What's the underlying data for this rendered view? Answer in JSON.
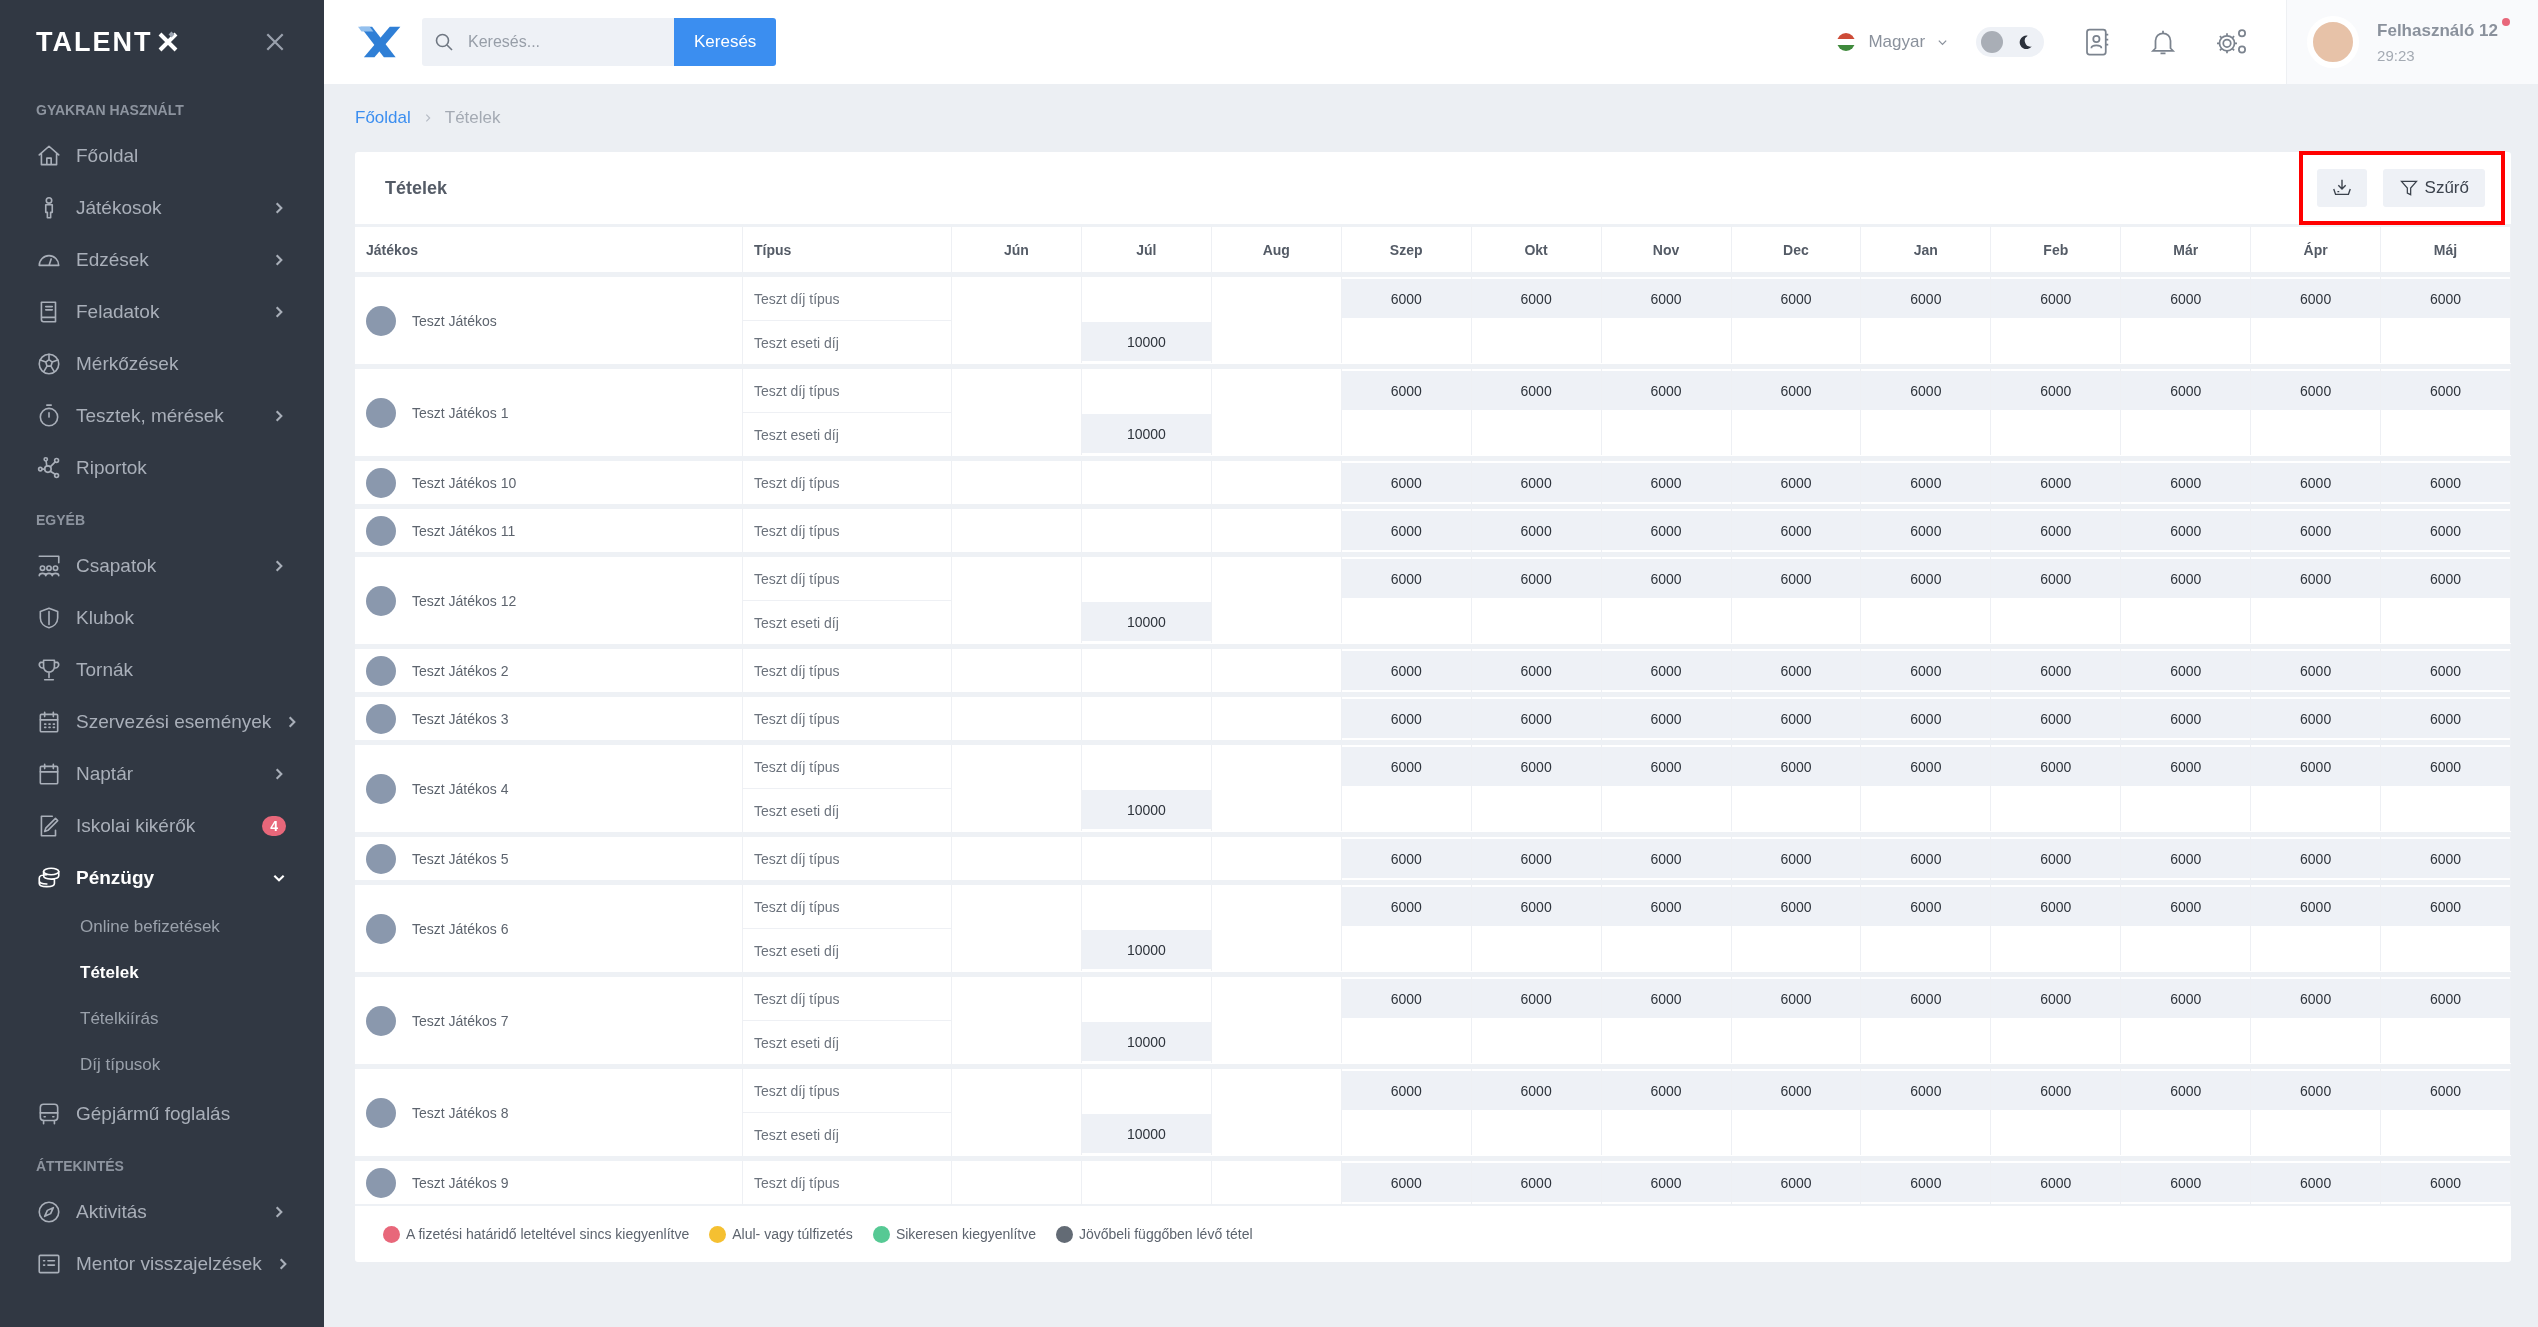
{
  "sidebar": {
    "logo": "TALENT",
    "sections": [
      {
        "title": "GYAKRAN HASZNÁLT",
        "items": [
          {
            "label": "Főoldal",
            "has_submenu": false,
            "selected": false
          },
          {
            "label": "Játékosok",
            "has_submenu": true,
            "expanded": false,
            "selected": false
          },
          {
            "label": "Edzések",
            "has_submenu": true,
            "expanded": false,
            "selected": false
          },
          {
            "label": "Feladatok",
            "has_submenu": true,
            "expanded": false,
            "selected": false
          },
          {
            "label": "Mérkőzések",
            "has_submenu": false,
            "selected": false
          },
          {
            "label": "Tesztek, mérések",
            "has_submenu": true,
            "expanded": false,
            "selected": false
          },
          {
            "label": "Riportok",
            "has_submenu": false,
            "selected": false
          }
        ]
      },
      {
        "title": "EGYÉB",
        "items": [
          {
            "label": "Csapatok",
            "has_submenu": true,
            "expanded": false,
            "selected": false
          },
          {
            "label": "Klubok",
            "has_submenu": false,
            "selected": false
          },
          {
            "label": "Tornák",
            "has_submenu": false,
            "selected": false
          },
          {
            "label": "Szervezési események",
            "has_submenu": true,
            "expanded": false,
            "selected": false
          },
          {
            "label": "Naptár",
            "has_submenu": true,
            "expanded": false,
            "selected": false
          },
          {
            "label": "Iskolai kikérők",
            "has_submenu": false,
            "selected": false,
            "badge": "4"
          },
          {
            "label": "Pénzügy",
            "has_submenu": true,
            "expanded": true,
            "selected": true,
            "children": [
              {
                "label": "Online befizetések",
                "selected": false
              },
              {
                "label": "Tételek",
                "selected": true
              },
              {
                "label": "Tételkiírás",
                "selected": false
              },
              {
                "label": "Díj típusok",
                "selected": false
              }
            ]
          },
          {
            "label": "Gépjármű foglalás",
            "has_submenu": false,
            "selected": false
          }
        ]
      },
      {
        "title": "ÁTTEKINTÉS",
        "items": [
          {
            "label": "Aktivitás",
            "has_submenu": true,
            "expanded": false,
            "selected": false
          },
          {
            "label": "Mentor visszajelzések",
            "has_submenu": true,
            "expanded": false,
            "selected": false
          }
        ]
      }
    ]
  },
  "header": {
    "search": {
      "placeholder": "Keresés..."
    },
    "search_button": "Keresés",
    "language": "Magyar",
    "dark_mode": false,
    "user": {
      "name": "Felhasználó 12",
      "time": "29:23",
      "notification": true
    }
  },
  "breadcrumb": [
    {
      "label": "Főoldal",
      "current": false
    },
    {
      "label": "Tételek",
      "current": true
    }
  ],
  "card": {
    "title": "Tételek",
    "filter_button": "Szűrő",
    "toolbar_highlighted": true
  },
  "table": {
    "columns": [
      "Játékos",
      "Típus",
      "Jún",
      "Júl",
      "Aug",
      "Szep",
      "Okt",
      "Nov",
      "Dec",
      "Jan",
      "Feb",
      "Már",
      "Ápr",
      "Máj"
    ],
    "players": [
      {
        "name": "Teszt Játékos",
        "rows": [
          {
            "type": "Teszt díj típus",
            "cells": [
              {},
              {},
              {},
              {
                "amount": "6000"
              },
              {
                "amount": "6000"
              },
              {
                "amount": "6000"
              },
              {
                "amount": "6000"
              },
              {
                "amount": "6000"
              },
              {
                "amount": "6000"
              },
              {
                "amount": "6000"
              },
              {
                "amount": "6000"
              },
              {
                "amount": "6000"
              }
            ]
          },
          {
            "type": "Teszt eseti díj",
            "cells": [
              {},
              {
                "amount": "10000"
              },
              {},
              {},
              {},
              {},
              {},
              {},
              {},
              {},
              {},
              {}
            ]
          }
        ]
      },
      {
        "name": "Teszt Játékos 1",
        "rows": [
          {
            "type": "Teszt díj típus",
            "cells": [
              {},
              {},
              {},
              {
                "amount": "6000"
              },
              {
                "amount": "6000"
              },
              {
                "amount": "6000"
              },
              {
                "amount": "6000"
              },
              {
                "amount": "6000"
              },
              {
                "amount": "6000"
              },
              {
                "amount": "6000"
              },
              {
                "amount": "6000"
              },
              {
                "amount": "6000"
              }
            ]
          },
          {
            "type": "Teszt eseti díj",
            "cells": [
              {},
              {
                "amount": "10000"
              },
              {},
              {},
              {},
              {},
              {},
              {},
              {},
              {},
              {},
              {}
            ]
          }
        ]
      },
      {
        "name": "Teszt Játékos 10",
        "rows": [
          {
            "type": "Teszt díj típus",
            "cells": [
              {},
              {},
              {},
              {
                "amount": "6000"
              },
              {
                "amount": "6000"
              },
              {
                "amount": "6000"
              },
              {
                "amount": "6000"
              },
              {
                "amount": "6000"
              },
              {
                "amount": "6000"
              },
              {
                "amount": "6000"
              },
              {
                "amount": "6000"
              },
              {
                "amount": "6000"
              }
            ]
          }
        ]
      },
      {
        "name": "Teszt Játékos 11",
        "rows": [
          {
            "type": "Teszt díj típus",
            "cells": [
              {},
              {},
              {},
              {
                "amount": "6000"
              },
              {
                "amount": "6000"
              },
              {
                "amount": "6000"
              },
              {
                "amount": "6000"
              },
              {
                "amount": "6000"
              },
              {
                "amount": "6000"
              },
              {
                "amount": "6000"
              },
              {
                "amount": "6000"
              },
              {
                "amount": "6000"
              }
            ]
          }
        ]
      },
      {
        "name": "Teszt Játékos 12",
        "rows": [
          {
            "type": "Teszt díj típus",
            "cells": [
              {},
              {},
              {},
              {
                "amount": "6000"
              },
              {
                "amount": "6000"
              },
              {
                "amount": "6000"
              },
              {
                "amount": "6000"
              },
              {
                "amount": "6000"
              },
              {
                "amount": "6000"
              },
              {
                "amount": "6000"
              },
              {
                "amount": "6000"
              },
              {
                "amount": "6000"
              }
            ]
          },
          {
            "type": "Teszt eseti díj",
            "cells": [
              {},
              {
                "amount": "10000"
              },
              {},
              {},
              {},
              {},
              {},
              {},
              {},
              {},
              {},
              {}
            ]
          }
        ]
      },
      {
        "name": "Teszt Játékos 2",
        "rows": [
          {
            "type": "Teszt díj típus",
            "cells": [
              {},
              {},
              {},
              {
                "amount": "6000"
              },
              {
                "amount": "6000"
              },
              {
                "amount": "6000"
              },
              {
                "amount": "6000"
              },
              {
                "amount": "6000"
              },
              {
                "amount": "6000"
              },
              {
                "amount": "6000"
              },
              {
                "amount": "6000"
              },
              {
                "amount": "6000"
              }
            ]
          }
        ]
      },
      {
        "name": "Teszt Játékos 3",
        "rows": [
          {
            "type": "Teszt díj típus",
            "cells": [
              {},
              {},
              {},
              {
                "amount": "6000"
              },
              {
                "amount": "6000"
              },
              {
                "amount": "6000"
              },
              {
                "amount": "6000"
              },
              {
                "amount": "6000"
              },
              {
                "amount": "6000"
              },
              {
                "amount": "6000"
              },
              {
                "amount": "6000"
              },
              {
                "amount": "6000"
              }
            ]
          }
        ]
      },
      {
        "name": "Teszt Játékos 4",
        "rows": [
          {
            "type": "Teszt díj típus",
            "cells": [
              {},
              {},
              {},
              {
                "amount": "6000"
              },
              {
                "amount": "6000"
              },
              {
                "amount": "6000"
              },
              {
                "amount": "6000"
              },
              {
                "amount": "6000"
              },
              {
                "amount": "6000"
              },
              {
                "amount": "6000"
              },
              {
                "amount": "6000"
              },
              {
                "amount": "6000"
              }
            ]
          },
          {
            "type": "Teszt eseti díj",
            "cells": [
              {},
              {
                "amount": "10000"
              },
              {},
              {},
              {},
              {},
              {},
              {},
              {},
              {},
              {},
              {}
            ]
          }
        ]
      },
      {
        "name": "Teszt Játékos 5",
        "rows": [
          {
            "type": "Teszt díj típus",
            "cells": [
              {},
              {},
              {},
              {
                "amount": "6000"
              },
              {
                "amount": "6000"
              },
              {
                "amount": "6000"
              },
              {
                "amount": "6000"
              },
              {
                "amount": "6000"
              },
              {
                "amount": "6000"
              },
              {
                "amount": "6000"
              },
              {
                "amount": "6000"
              },
              {
                "amount": "6000"
              }
            ]
          }
        ]
      },
      {
        "name": "Teszt Játékos 6",
        "rows": [
          {
            "type": "Teszt díj típus",
            "cells": [
              {},
              {},
              {},
              {
                "amount": "6000"
              },
              {
                "amount": "6000"
              },
              {
                "amount": "6000"
              },
              {
                "amount": "6000"
              },
              {
                "amount": "6000"
              },
              {
                "amount": "6000"
              },
              {
                "amount": "6000"
              },
              {
                "amount": "6000"
              },
              {
                "amount": "6000"
              }
            ]
          },
          {
            "type": "Teszt eseti díj",
            "cells": [
              {},
              {
                "amount": "10000"
              },
              {},
              {},
              {},
              {},
              {},
              {},
              {},
              {},
              {},
              {}
            ]
          }
        ]
      },
      {
        "name": "Teszt Játékos 7",
        "rows": [
          {
            "type": "Teszt díj típus",
            "cells": [
              {},
              {},
              {},
              {
                "amount": "6000"
              },
              {
                "amount": "6000"
              },
              {
                "amount": "6000"
              },
              {
                "amount": "6000"
              },
              {
                "amount": "6000"
              },
              {
                "amount": "6000"
              },
              {
                "amount": "6000"
              },
              {
                "amount": "6000"
              },
              {
                "amount": "6000"
              }
            ]
          },
          {
            "type": "Teszt eseti díj",
            "cells": [
              {},
              {
                "amount": "10000"
              },
              {},
              {},
              {},
              {},
              {},
              {},
              {},
              {},
              {},
              {}
            ]
          }
        ]
      },
      {
        "name": "Teszt Játékos 8",
        "rows": [
          {
            "type": "Teszt díj típus",
            "cells": [
              {},
              {},
              {},
              {
                "amount": "6000"
              },
              {
                "amount": "6000"
              },
              {
                "amount": "6000"
              },
              {
                "amount": "6000"
              },
              {
                "amount": "6000"
              },
              {
                "amount": "6000"
              },
              {
                "amount": "6000"
              },
              {
                "amount": "6000"
              },
              {
                "amount": "6000"
              }
            ]
          },
          {
            "type": "Teszt eseti díj",
            "cells": [
              {},
              {
                "amount": "10000"
              },
              {},
              {},
              {},
              {},
              {},
              {},
              {},
              {},
              {},
              {}
            ]
          }
        ]
      },
      {
        "name": "Teszt Játékos 9",
        "rows": [
          {
            "type": "Teszt díj típus",
            "cells": [
              {},
              {},
              {},
              {
                "amount": "6000"
              },
              {
                "amount": "6000"
              },
              {
                "amount": "6000"
              },
              {
                "amount": "6000"
              },
              {
                "amount": "6000"
              },
              {
                "amount": "6000"
              },
              {
                "amount": "6000"
              },
              {
                "amount": "6000"
              },
              {
                "amount": "6000"
              }
            ]
          }
        ]
      }
    ]
  },
  "legend": [
    {
      "label": "A fizetési határidő leteltével sincs kiegyenlítve",
      "color": "#e8677a"
    },
    {
      "label": "Alul- vagy túlfizetés",
      "color": "#f5c031"
    },
    {
      "label": "Sikeresen kiegyenlítve",
      "color": "#56c994"
    },
    {
      "label": "Jövőbeli függőben lévő tétel",
      "color": "#636b75"
    }
  ]
}
